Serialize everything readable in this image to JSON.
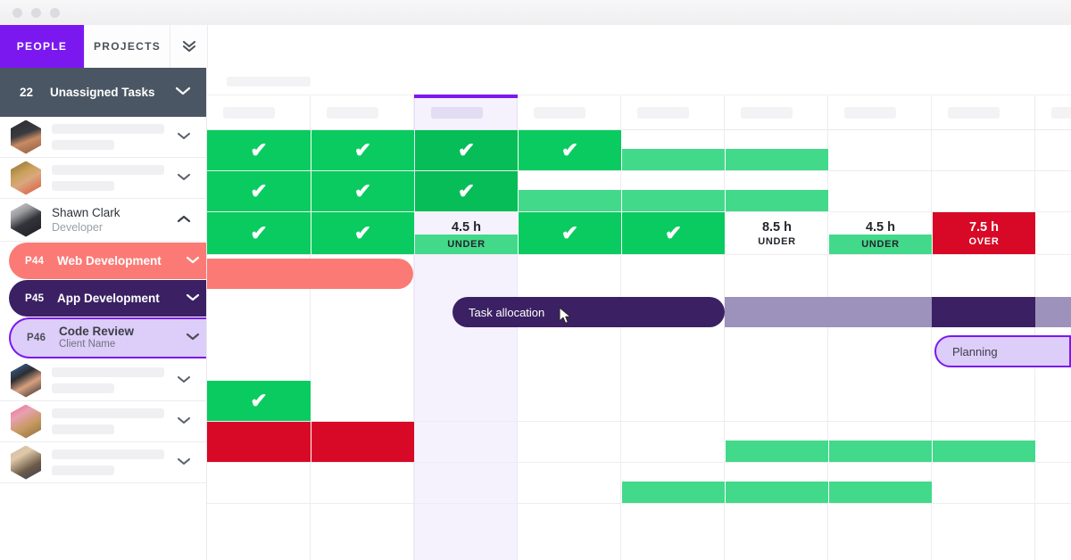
{
  "window": {
    "dots": [
      "close-dot",
      "minimize-dot",
      "maximize-dot"
    ]
  },
  "tabs": [
    {
      "label": "PEOPLE",
      "active": true
    },
    {
      "label": "PROJECTS",
      "active": false
    }
  ],
  "tab_caret_icon": "chevron-double-down-icon",
  "unassigned": {
    "count": "22",
    "label": "Unassigned Tasks",
    "caret_icon": "chevron-down-icon"
  },
  "people": [
    {
      "name": "",
      "role": "",
      "placeholder": true,
      "caret_icon": "chevron-down-icon"
    },
    {
      "name": "",
      "role": "",
      "placeholder": true,
      "caret_icon": "chevron-down-icon"
    },
    {
      "name": "Shawn Clark",
      "role": "Developer",
      "placeholder": false,
      "expanded": true,
      "caret_icon": "chevron-up-icon"
    },
    {
      "name": "",
      "role": "",
      "placeholder": true,
      "caret_icon": "chevron-down-icon"
    },
    {
      "name": "",
      "role": "",
      "placeholder": true,
      "caret_icon": "chevron-down-icon"
    },
    {
      "name": "",
      "role": "",
      "placeholder": true,
      "caret_icon": "chevron-down-icon"
    }
  ],
  "projects": [
    {
      "id": "P44",
      "name": "Web Development",
      "client": "",
      "color": "#fb7a75",
      "selected": false,
      "caret_icon": "chevron-down-icon"
    },
    {
      "id": "P45",
      "name": "App Development",
      "client": "",
      "color": "#3b2063",
      "selected": false,
      "caret_icon": "chevron-down-icon"
    },
    {
      "id": "P46",
      "name": "Code Review",
      "client": "Client Name",
      "color": "#ddcdf9",
      "selected": true,
      "caret_icon": "chevron-down-icon"
    }
  ],
  "timeline": {
    "column_count": 9,
    "selected_column_index": 2,
    "accent": "#7b18f0"
  },
  "workload": {
    "cells": [
      {
        "column": 4,
        "hours": "8.5 h",
        "status": "UNDER",
        "bar": false
      },
      {
        "column": 6,
        "hours": "4.5 h",
        "status": "UNDER",
        "bar": true
      },
      {
        "column": 7,
        "hours": "7.5 h",
        "status": "OVER",
        "bar": false
      }
    ],
    "selected_cell": {
      "column": 2,
      "hours": "4.5 h",
      "status": "UNDER",
      "bar": true
    }
  },
  "bars": {
    "task_allocation_label": "Task allocation",
    "planning_label": "Planning"
  },
  "colors": {
    "accent_purple": "#7b18f0",
    "dark_purple": "#3b2063",
    "light_purple": "#ddcdf9",
    "salmon": "#fb7a75",
    "green": "#0acb5f",
    "green_light": "#42d98a",
    "red": "#d70926",
    "slate": "#4a5663"
  }
}
